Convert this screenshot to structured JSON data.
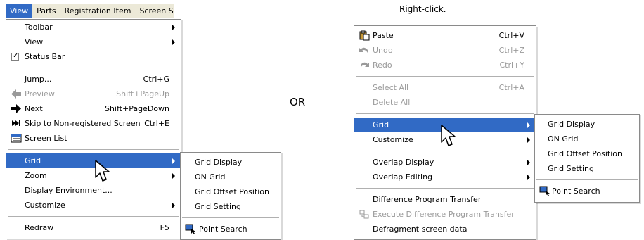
{
  "left": {
    "menubar": [
      "View",
      "Parts",
      "Registration Item",
      "Screen Se"
    ],
    "view_menu": [
      {
        "label": "Toolbar",
        "submenu": true
      },
      {
        "label": "View",
        "submenu": true
      },
      {
        "label": "Status Bar",
        "checked": true
      },
      {
        "label": "Jump...",
        "shortcut": "Ctrl+G"
      },
      {
        "label": "Preview",
        "shortcut": "Shift+PageUp",
        "disabled": true,
        "icon": "left-arrow-icon"
      },
      {
        "label": "Next",
        "shortcut": "Shift+PageDown",
        "icon": "right-arrow-icon"
      },
      {
        "label": "Skip to Non-registered Screen",
        "shortcut": "Ctrl+E",
        "icon": "skip-icon"
      },
      {
        "label": "Screen List",
        "icon": "screen-list-icon"
      },
      {
        "label": "Grid",
        "submenu": true,
        "highlighted": true
      },
      {
        "label": "Zoom",
        "submenu": true
      },
      {
        "label": "Display Environment..."
      },
      {
        "label": "Customize",
        "submenu": true
      },
      {
        "label": "Redraw",
        "shortcut": "F5"
      }
    ],
    "grid_submenu": [
      {
        "label": "Grid Display"
      },
      {
        "label": "ON Grid"
      },
      {
        "label": "Grid Offset Position"
      },
      {
        "label": "Grid Setting"
      },
      {
        "label": "Point Search",
        "icon": "point-search-icon"
      }
    ]
  },
  "or_label": "OR",
  "right_click_label": "Right-click.",
  "right": {
    "context_menu": [
      {
        "label": "Paste",
        "shortcut": "Ctrl+V",
        "icon": "paste-icon"
      },
      {
        "label": "Undo",
        "shortcut": "Ctrl+Z",
        "disabled": true,
        "icon": "undo-icon"
      },
      {
        "label": "Redo",
        "shortcut": "Ctrl+Y",
        "disabled": true,
        "icon": "redo-icon"
      },
      {
        "label": "Select All",
        "shortcut": "Ctrl+A",
        "disabled": true
      },
      {
        "label": "Delete All",
        "disabled": true
      },
      {
        "label": "Grid",
        "submenu": true,
        "highlighted": true
      },
      {
        "label": "Customize",
        "submenu": true
      },
      {
        "label": "Overlap Display",
        "submenu": true
      },
      {
        "label": "Overlap Editing",
        "submenu": true
      },
      {
        "label": "Difference Program Transfer"
      },
      {
        "label": "Execute Difference Program Transfer",
        "disabled": true,
        "icon": "execute-transfer-icon"
      },
      {
        "label": "Defragment screen data"
      }
    ],
    "grid_submenu": [
      {
        "label": "Grid Display"
      },
      {
        "label": "ON Grid"
      },
      {
        "label": "Grid Offset Position"
      },
      {
        "label": "Grid Setting"
      },
      {
        "label": "Point Search",
        "icon": "point-search-icon"
      }
    ]
  }
}
